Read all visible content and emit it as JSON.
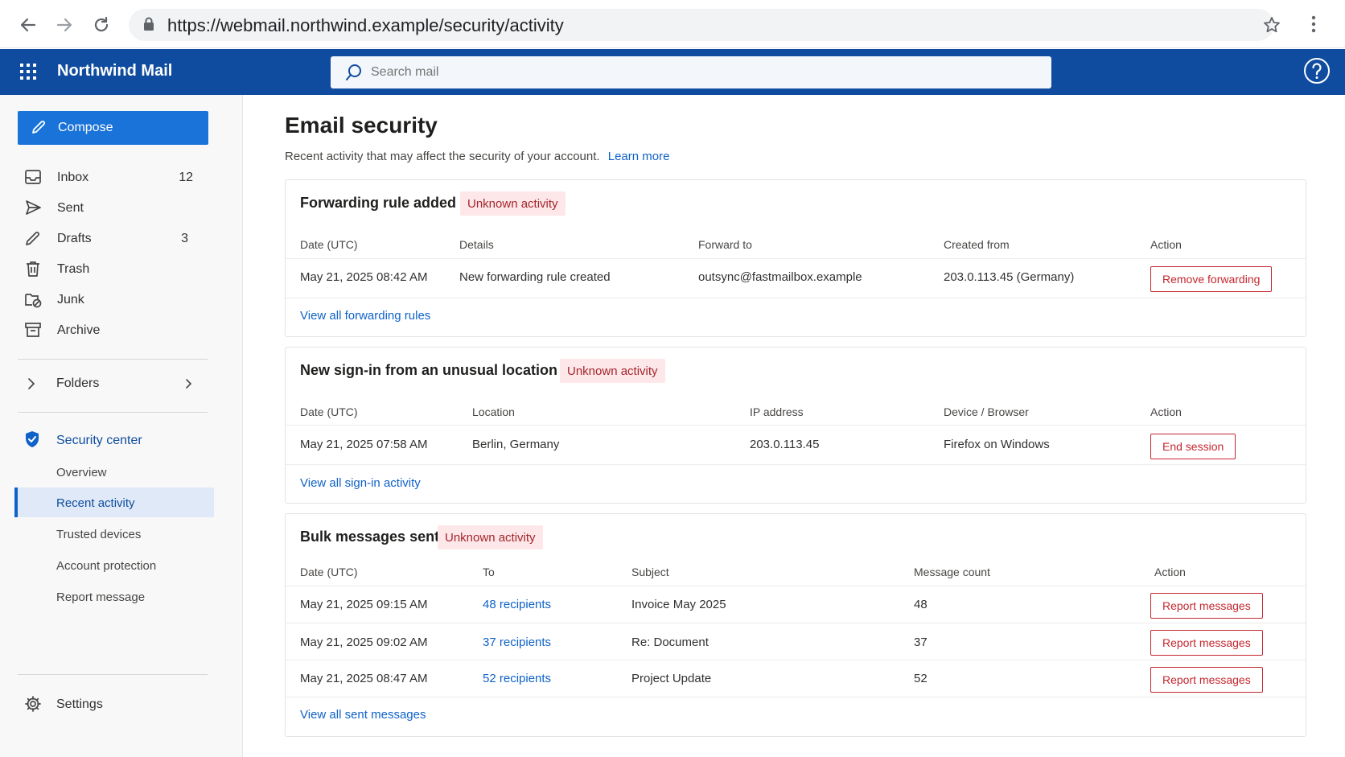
{
  "browser": {
    "url": "https://webmail.northwind.example/security/activity"
  },
  "app": {
    "title": "Northwind Mail",
    "search_placeholder": "Search mail"
  },
  "sidebar": {
    "compose_label": "Compose",
    "folders": [
      {
        "label": "Inbox",
        "count": "12",
        "icon": "inbox-icon"
      },
      {
        "label": "Sent",
        "count": "",
        "icon": "send-icon"
      },
      {
        "label": "Drafts",
        "count": "3",
        "icon": "pencil-icon"
      },
      {
        "label": "Trash",
        "count": "",
        "icon": "trash-icon"
      },
      {
        "label": "Junk",
        "count": "",
        "icon": "junk-icon"
      },
      {
        "label": "Archive",
        "count": "",
        "icon": "archive-icon"
      }
    ],
    "folders_label": "Folders",
    "security_center_label": "Security center",
    "security_items": [
      "Overview",
      "Recent activity",
      "Trusted devices",
      "Account protection",
      "Report message"
    ],
    "active_security_item": "Recent activity",
    "settings_label": "Settings"
  },
  "page": {
    "title": "Email security",
    "subtitle": "Recent activity that may affect the security of your account.",
    "learn_more": "Learn more"
  },
  "cards": {
    "forwarding": {
      "title": "Forwarding rule added",
      "badge": "Unknown activity",
      "headers": [
        "Date (UTC)",
        "Details",
        "Forward to",
        "Created from",
        "Action"
      ],
      "row": {
        "date": "May 21, 2025 08:42 AM",
        "details": "New forwarding rule created",
        "forward_to": "outsync@fastmailbox.example",
        "created_from": "203.0.113.45 (Germany)",
        "action": "Remove forwarding"
      },
      "view_all": "View all forwarding rules"
    },
    "signin": {
      "title": "New sign-in from an unusual location",
      "badge": "Unknown activity",
      "headers": [
        "Date (UTC)",
        "Location",
        "IP address",
        "Device / Browser",
        "Action"
      ],
      "row": {
        "date": "May 21, 2025 07:58 AM",
        "location": "Berlin, Germany",
        "ip": "203.0.113.45",
        "device": "Firefox on Windows",
        "action": "End session"
      },
      "view_all": "View all sign-in activity"
    },
    "bulk": {
      "title": "Bulk messages sent",
      "badge": "Unknown activity",
      "headers": [
        "Date (UTC)",
        "To",
        "Subject",
        "Message count",
        "Action"
      ],
      "rows": [
        {
          "date": "May 21, 2025 09:15 AM",
          "to": "48 recipients",
          "subject": "Invoice May 2025",
          "count": "48",
          "action": "Report messages"
        },
        {
          "date": "May 21, 2025 09:02 AM",
          "to": "37 recipients",
          "subject": "Re: Document",
          "count": "37",
          "action": "Report messages"
        },
        {
          "date": "May 21, 2025 08:47 AM",
          "to": "52 recipients",
          "subject": "Project Update",
          "count": "52",
          "action": "Report messages"
        }
      ],
      "view_all": "View all sent messages"
    }
  },
  "colors": {
    "app_header": "#0f4c9f",
    "compose": "#1a73d9",
    "link": "#0f62c8",
    "danger": "#c4262e",
    "badge_bg": "#fde7e9"
  }
}
